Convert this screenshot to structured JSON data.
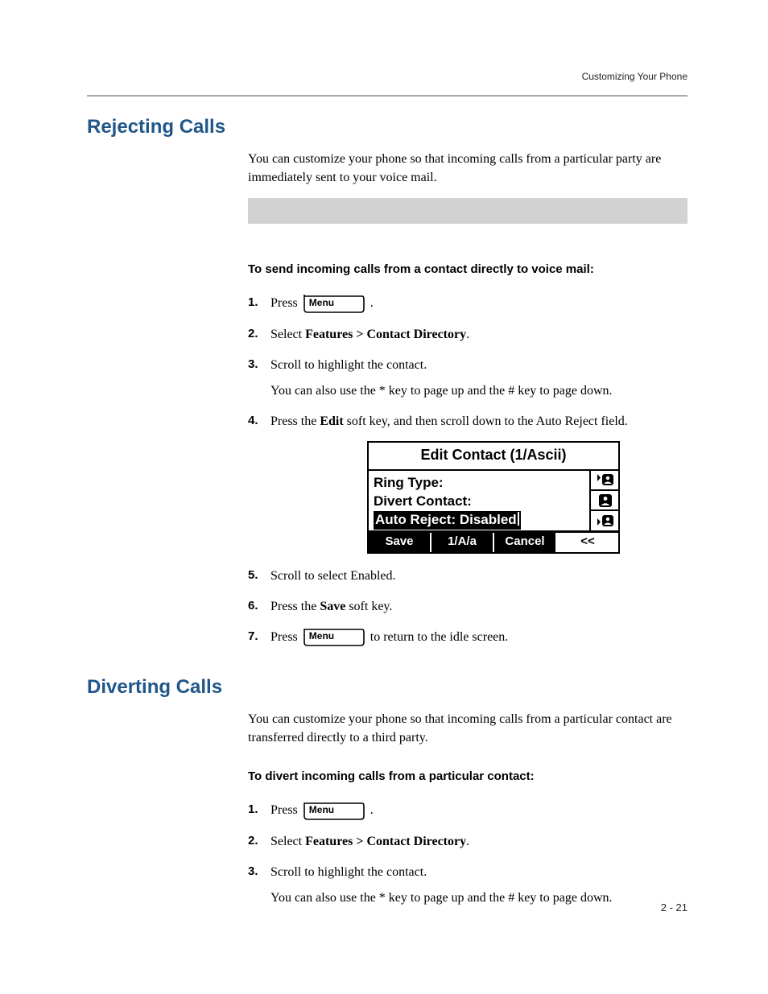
{
  "header": {
    "breadcrumb": "Customizing Your Phone"
  },
  "section1": {
    "title": "Rejecting Calls",
    "intro": "You can customize your phone so that incoming calls from a particular party are immediately sent to your voice mail.",
    "subhead": "To send incoming calls from a contact directly to voice mail:",
    "step1_pre": "Press ",
    "step1_post": " .",
    "step2_pre": "Select ",
    "step2_bold": "Features > Contact Directory",
    "step2_post": ".",
    "step3": "Scroll to highlight the contact.",
    "step3_note": "You can also use the * key to page up and the # key to page down.",
    "step4_pre": "Press the ",
    "step4_bold": "Edit",
    "step4_post": " soft key, and then scroll down to the Auto Reject field.",
    "step5": "Scroll to select Enabled.",
    "step6_pre": "Press the ",
    "step6_bold": "Save",
    "step6_post": " soft key.",
    "step7_pre": "Press ",
    "step7_post": " to return to the idle screen."
  },
  "keycap": {
    "label": "Menu"
  },
  "lcd": {
    "title": "Edit Contact (1/Ascii)",
    "row1": "Ring Type:",
    "row2": "Divert Contact:",
    "row3": "Auto Reject: Disabled",
    "soft1": "Save",
    "soft2": "1/A/a",
    "soft3": "Cancel",
    "soft4": "<<"
  },
  "section2": {
    "title": "Diverting Calls",
    "intro": "You can customize your phone so that incoming calls from a particular contact are transferred directly to a third party.",
    "subhead": "To divert incoming calls from a particular contact:",
    "step1_pre": "Press ",
    "step1_post": " .",
    "step2_pre": "Select ",
    "step2_bold": "Features > Contact Directory",
    "step2_post": ".",
    "step3": "Scroll to highlight the contact.",
    "step3_note": "You can also use the * key to page up and the # key to page down."
  },
  "footer": {
    "page": "2 - 21"
  }
}
